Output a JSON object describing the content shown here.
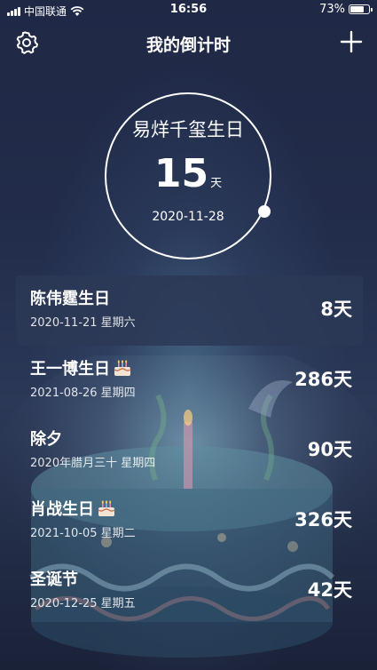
{
  "status_bar": {
    "carrier": "中国联通",
    "time": "16:56",
    "battery_text": "73%",
    "battery_level": 0.73
  },
  "header": {
    "title": "我的倒计时",
    "left_icon": "gear-icon",
    "right_icon": "plus-icon"
  },
  "featured": {
    "name": "易烊千玺生日",
    "days": "15",
    "unit": "天",
    "date": "2020-11-28"
  },
  "events": [
    {
      "name": "陈伟霆生日",
      "has_cake_icon": false,
      "date": "2020-11-21 星期六",
      "days": "8天"
    },
    {
      "name": "王一博生日",
      "has_cake_icon": true,
      "date": "2021-08-26 星期四",
      "days": "286天"
    },
    {
      "name": "除夕",
      "has_cake_icon": false,
      "date": "2020年腊月三十 星期四",
      "days": "90天"
    },
    {
      "name": "肖战生日",
      "has_cake_icon": true,
      "date": "2021-10-05 星期二",
      "days": "326天"
    },
    {
      "name": "圣诞节",
      "has_cake_icon": false,
      "date": "2020-12-25 星期五",
      "days": "42天"
    }
  ],
  "colors": {
    "background": "#1f2845",
    "text": "#ffffff",
    "highlight_row": "#2c3856"
  }
}
